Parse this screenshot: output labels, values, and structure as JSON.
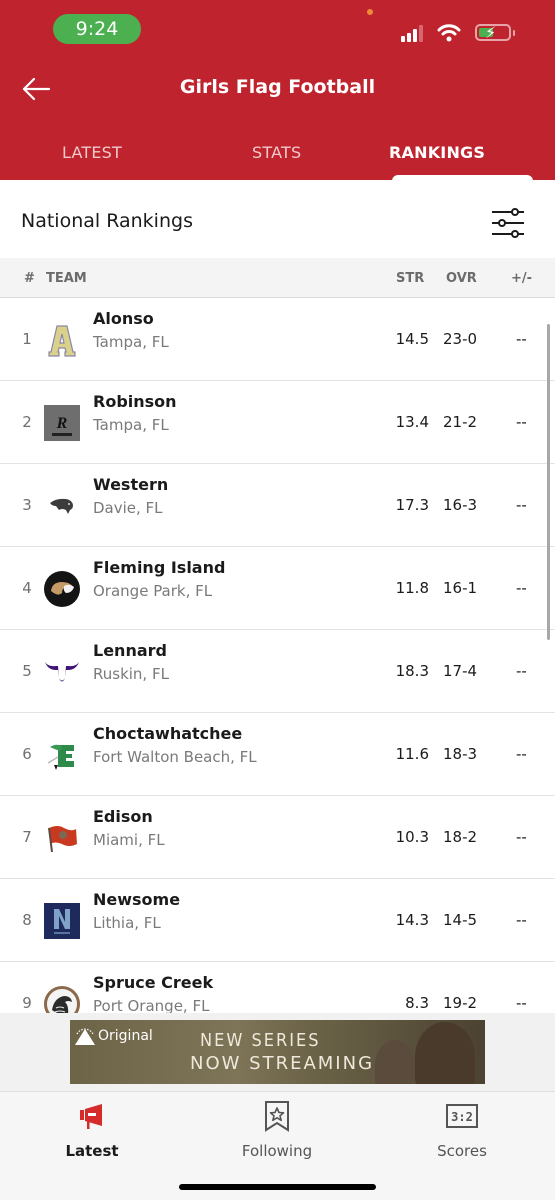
{
  "status_bar": {
    "time": "9:24",
    "signal_bars": 3,
    "battery_charging": true
  },
  "header": {
    "title": "Girls Flag Football",
    "back_icon": "arrow-left-icon",
    "tabs": [
      {
        "label": "LATEST",
        "active": false
      },
      {
        "label": "STATS",
        "active": false
      },
      {
        "label": "RANKINGS",
        "active": true
      }
    ]
  },
  "section": {
    "title": "National Rankings",
    "filter_icon": "sliders-icon"
  },
  "columns": {
    "rank": "#",
    "team": "TEAM",
    "str": "STR",
    "ovr": "OVR",
    "change": "+/-"
  },
  "rankings": [
    {
      "rank": "1",
      "name": "Alonso",
      "location": "Tampa, FL",
      "str": "14.5",
      "ovr": "23-0",
      "change": "--",
      "logo": "alonso-a-logo"
    },
    {
      "rank": "2",
      "name": "Robinson",
      "location": "Tampa, FL",
      "str": "13.4",
      "ovr": "21-2",
      "change": "--",
      "logo": "robinson-r-logo"
    },
    {
      "rank": "3",
      "name": "Western",
      "location": "Davie, FL",
      "str": "17.3",
      "ovr": "16-3",
      "change": "--",
      "logo": "western-panther-logo"
    },
    {
      "rank": "4",
      "name": "Fleming Island",
      "location": "Orange Park, FL",
      "str": "11.8",
      "ovr": "16-1",
      "change": "--",
      "logo": "fleming-island-eagle-logo"
    },
    {
      "rank": "5",
      "name": "Lennard",
      "location": "Ruskin, FL",
      "str": "18.3",
      "ovr": "17-4",
      "change": "--",
      "logo": "lennard-longhorn-logo"
    },
    {
      "rank": "6",
      "name": "Choctawhatchee",
      "location": "Fort Walton Beach, FL",
      "str": "11.6",
      "ovr": "18-3",
      "change": "--",
      "logo": "choctawhatchee-c-logo"
    },
    {
      "rank": "7",
      "name": "Edison",
      "location": "Miami, FL",
      "str": "10.3",
      "ovr": "18-2",
      "change": "--",
      "logo": "edison-flag-logo"
    },
    {
      "rank": "8",
      "name": "Newsome",
      "location": "Lithia, FL",
      "str": "14.3",
      "ovr": "14-5",
      "change": "--",
      "logo": "newsome-n-logo"
    },
    {
      "rank": "9",
      "name": "Spruce Creek",
      "location": "Port Orange, FL",
      "str": "8.3",
      "ovr": "19-2",
      "change": "--",
      "logo": "spruce-creek-hawk-logo"
    }
  ],
  "ad": {
    "brand": "Original",
    "line1": "NEW SERIES",
    "line2": "NOW STREAMING"
  },
  "tabbar": [
    {
      "label": "Latest",
      "icon": "megaphone-icon",
      "active": true
    },
    {
      "label": "Following",
      "icon": "bookmark-star-icon",
      "active": false
    },
    {
      "label": "Scores",
      "icon": "scoreboard-icon",
      "active": false
    }
  ],
  "colors": {
    "brand_red": "#bf242e",
    "status_green": "#4caf50"
  }
}
